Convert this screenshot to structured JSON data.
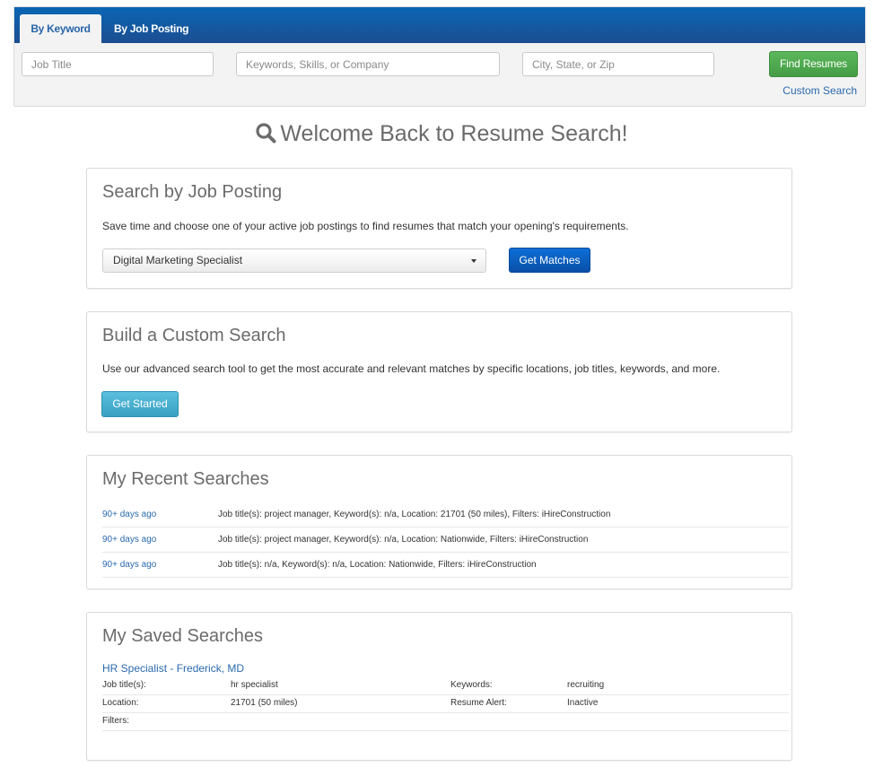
{
  "search_bar": {
    "tabs": [
      {
        "label": "By Keyword",
        "active": true
      },
      {
        "label": "By Job Posting",
        "active": false
      }
    ],
    "job_title_placeholder": "Job Title",
    "keywords_placeholder": "Keywords, Skills, or Company",
    "location_placeholder": "City, State, or Zip",
    "find_button": "Find Resumes",
    "custom_search_link": "Custom Search"
  },
  "welcome": {
    "icon": "search-icon",
    "title": "Welcome Back to Resume Search!"
  },
  "job_posting_panel": {
    "title": "Search by Job Posting",
    "description": "Save time and choose one of your active job postings to find resumes that match your opening's requirements.",
    "selected_posting": "Digital Marketing Specialist",
    "button": "Get Matches"
  },
  "custom_search_panel": {
    "title": "Build a Custom Search",
    "description": "Use our advanced search tool to get the most accurate and relevant matches by specific locations, job titles, keywords, and more.",
    "button": "Get Started"
  },
  "recent_searches": {
    "title": "My Recent Searches",
    "rows": [
      {
        "when": "90+ days ago",
        "desc": "Job title(s): project manager, Keyword(s): n/a, Location: 21701 (50 miles), Filters: iHireConstruction"
      },
      {
        "when": "90+ days ago",
        "desc": "Job title(s): project manager, Keyword(s): n/a, Location: Nationwide, Filters: iHireConstruction"
      },
      {
        "when": "90+ days ago",
        "desc": "Job title(s): n/a, Keyword(s): n/a, Location: Nationwide, Filters: iHireConstruction"
      }
    ]
  },
  "saved_searches": {
    "title": "My Saved Searches",
    "item": {
      "name": "HR Specialist - Frederick, MD",
      "job_titles_label": "Job title(s):",
      "job_titles_value": "hr specialist",
      "keywords_label": "Keywords:",
      "keywords_value": "recruiting",
      "location_label": "Location:",
      "location_value": "21701 (50 miles)",
      "alert_label": "Resume Alert:",
      "alert_value": "Inactive",
      "filters_label": "Filters:",
      "filters_value": ""
    }
  },
  "colors": {
    "header_gradient_top": "#0a66b4",
    "header_gradient_bottom": "#1c4e91",
    "link": "#2a6aae",
    "find_button": "#5cb85c",
    "get_matches_button": "#0d6fd6",
    "get_started_button": "#5bc0de"
  }
}
